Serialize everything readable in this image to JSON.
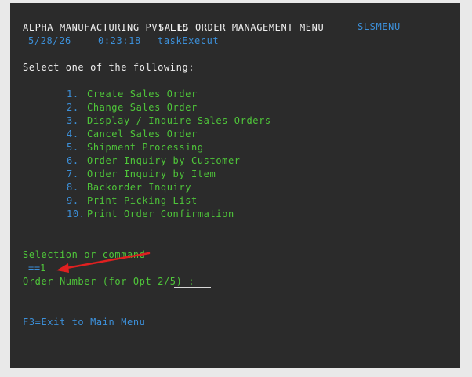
{
  "header": {
    "company": "ALPHA MANUFACTURING PVT LTD",
    "menu_title": "SALES ORDER MANAGEMENT MENU",
    "menu_id": "SLSMENU",
    "date": "5/28/26",
    "time": "0:23:18",
    "task": "taskExecut"
  },
  "prompt": "Select one of the following:",
  "menu": [
    {
      "num": "1.",
      "label": "Create Sales Order"
    },
    {
      "num": "2.",
      "label": "Change Sales Order"
    },
    {
      "num": "3.",
      "label": "Display / Inquire Sales Orders"
    },
    {
      "num": "4.",
      "label": "Cancel Sales Order"
    },
    {
      "num": "5.",
      "label": "Shipment Processing"
    },
    {
      "num": "6.",
      "label": "Order Inquiry by Customer"
    },
    {
      "num": "7.",
      "label": "Order Inquiry by Item"
    },
    {
      "num": "8.",
      "label": "Backorder Inquiry"
    },
    {
      "num": "9.",
      "label": "Print Picking List"
    },
    {
      "num": "10.",
      "label": "Print Order Confirmation"
    }
  ],
  "command": {
    "label": "Selection or command",
    "prefix": "==",
    "value": "1"
  },
  "order_number": {
    "label": "Order Number (for Opt 2/5) :",
    "value": ""
  },
  "function_keys": "F3=Exit to Main Menu",
  "colors": {
    "background": "#2b2b2b",
    "text_white": "#f0f0f0",
    "text_green": "#4fc63a",
    "text_blue": "#3c8fd8",
    "annotation_arrow": "#e02020"
  }
}
